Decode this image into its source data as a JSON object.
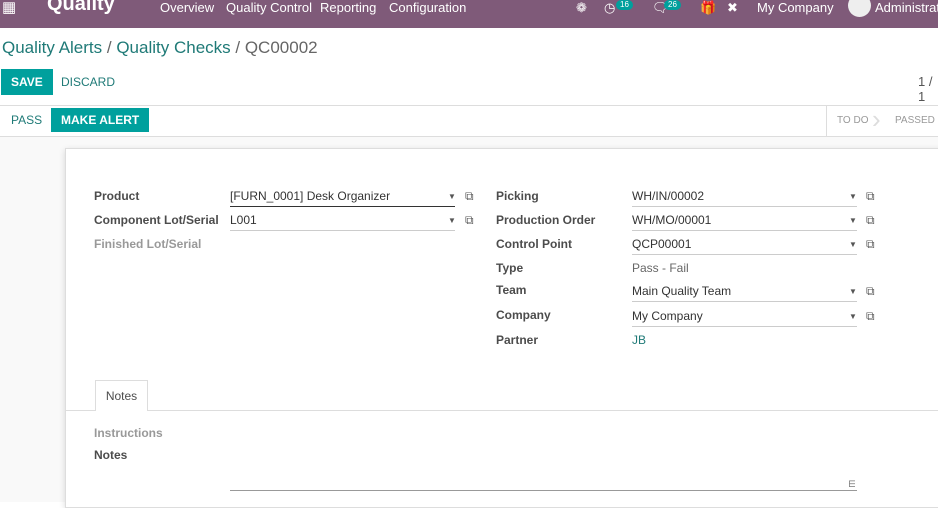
{
  "navbar": {
    "app": "Quality",
    "menu": [
      "Overview",
      "Quality Control",
      "Reporting",
      "Configuration"
    ],
    "activity_count": "16",
    "message_count": "26",
    "company": "My Company",
    "user": "Administrator",
    "color": "#7f5a79"
  },
  "breadcrumb": {
    "items": [
      "Quality Alerts",
      "Quality Checks"
    ],
    "current": "QC00002"
  },
  "actions": {
    "save": "SAVE",
    "discard": "DISCARD",
    "pager": "1 / 1"
  },
  "statusbar": {
    "pass": "PASS",
    "make_alert": "MAKE ALERT",
    "stages": [
      "TO DO",
      "PASSED"
    ]
  },
  "form": {
    "left": [
      {
        "label": "Product",
        "value": "[FURN_0001] Desk Organizer"
      },
      {
        "label": "Component Lot/Serial",
        "value": "L001"
      },
      {
        "label": "Finished Lot/Serial",
        "value": ""
      }
    ],
    "right": [
      {
        "label": "Picking",
        "value": "WH/IN/00002"
      },
      {
        "label": "Production Order",
        "value": "WH/MO/00001"
      },
      {
        "label": "Control Point",
        "value": "QCP00001"
      },
      {
        "label": "Type",
        "value": "Pass - Fail"
      },
      {
        "label": "Team",
        "value": "Main Quality Team"
      },
      {
        "label": "Company",
        "value": "My Company"
      },
      {
        "label": "Partner",
        "value": "JB"
      }
    ],
    "tab": "Notes",
    "instructions_label": "Instructions",
    "notes_label": "Notes"
  },
  "accent": "#00a09d"
}
